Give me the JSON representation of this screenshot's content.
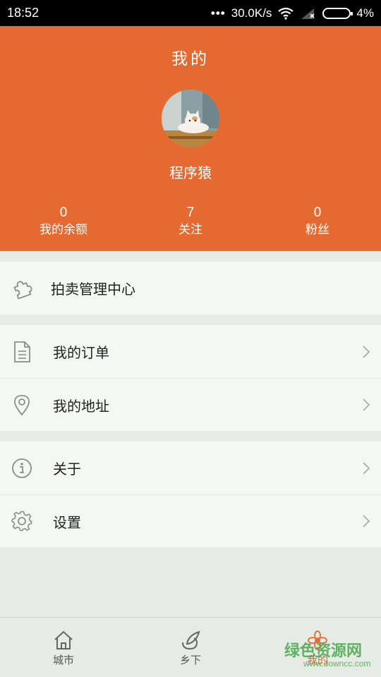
{
  "status_bar": {
    "time": "18:52",
    "dots": "•••",
    "network_speed": "30.0K/s",
    "battery_percent": "4%"
  },
  "header": {
    "title": "我的",
    "username": "程序猿",
    "stats": [
      {
        "value": "0",
        "label": "我的余额"
      },
      {
        "value": "7",
        "label": "关注"
      },
      {
        "value": "0",
        "label": "粉丝"
      }
    ]
  },
  "menu": {
    "auction": {
      "label": "拍卖管理中心",
      "icon": "puzzle-icon"
    },
    "orders": {
      "label": "我的订单",
      "icon": "document-icon"
    },
    "address": {
      "label": "我的地址",
      "icon": "location-pin-icon"
    },
    "about": {
      "label": "关于",
      "icon": "info-icon"
    },
    "settings": {
      "label": "设置",
      "icon": "gear-icon"
    }
  },
  "tabbar": {
    "items": [
      {
        "label": "城市",
        "icon": "home-icon"
      },
      {
        "label": "乡下",
        "icon": "leaf-icon"
      },
      {
        "label": "我的",
        "icon": "flower-icon",
        "active": true
      }
    ]
  },
  "watermark": {
    "text": "绿色资源网",
    "url": "www.downcc.com"
  },
  "colors": {
    "accent": "#e56a31",
    "background": "#e6ebe5",
    "row_bg": "#f3f8f2"
  }
}
